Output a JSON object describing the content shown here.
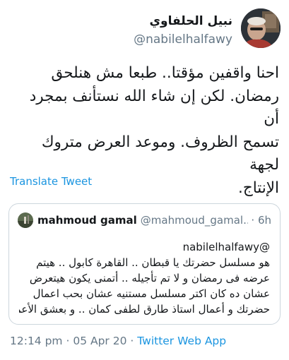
{
  "author": {
    "display_name": "نبيل الحلفاوي",
    "handle": "@nabilelhalfawy"
  },
  "tweet": {
    "lines": [
      "احنا واقفين مؤقتا.. طبعا مش هنلحق",
      "رمضان. لكن إن شاء الله نستأنف بمجرد أن",
      "تسمح الظروف. وموعد العرض متروك لجهة",
      "الإنتاج."
    ]
  },
  "translate_label": "Translate Tweet",
  "quoted": {
    "name": "mahmoud gamal",
    "handle": "@mahmoud_gamal...",
    "time": "· 6h",
    "lines": [
      "@nabilelhalfawy",
      "هو مسلسل حضرتك يا قبطان .. القاهرة كابول .. هيتم",
      "عرضه فى رمضان و لا تم تأجيله .. أتمنى يكون هيتعرض",
      "عشان ده كان اكتر مسلسل مستنيه عشان بحب اعمال",
      "حضرتك و أعمال استاذ طارق لطفى كمان .. و بعشق الأعم..."
    ]
  },
  "meta": {
    "time": "12:14 pm",
    "sep1": " · ",
    "date": "05 Apr 20",
    "sep2": " · ",
    "app": "Twitter Web App"
  }
}
